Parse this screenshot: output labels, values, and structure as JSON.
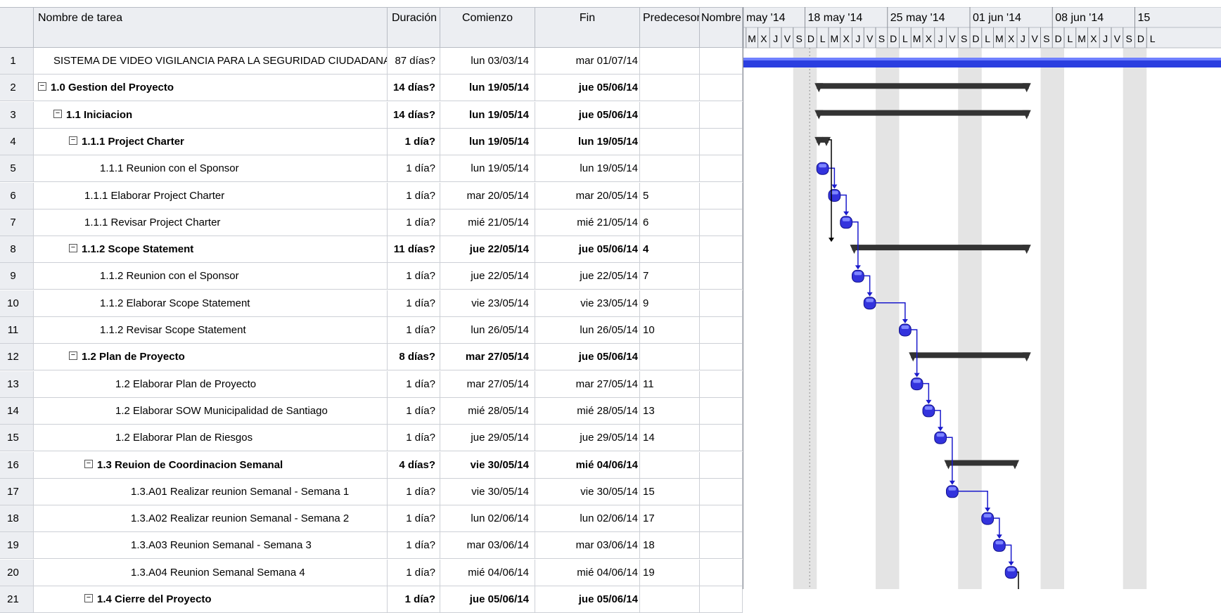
{
  "columns": {
    "name": "Nombre de tarea",
    "duration": "Duración",
    "start": "Comienzo",
    "finish": "Fin",
    "predecessors": "Predecesora",
    "resources": "Nombre"
  },
  "timescale": {
    "weeks": [
      "may '14",
      "18 may '14",
      "25 may '14",
      "01 jun '14",
      "08 jun '14",
      "15"
    ],
    "days": [
      "L",
      "M",
      "X",
      "J",
      "V",
      "S",
      "D",
      "L",
      "M",
      "X",
      "J",
      "V",
      "S",
      "D",
      "L",
      "M",
      "X",
      "J",
      "V",
      "S",
      "D",
      "L",
      "M",
      "X",
      "J",
      "V",
      "S",
      "D",
      "L",
      "M",
      "X",
      "J",
      "V",
      "S",
      "D",
      "L"
    ]
  },
  "tasks": [
    {
      "id": "1",
      "name": "SISTEMA DE VIDEO VIGILANCIA PARA LA SEGURIDAD CIUDADANA",
      "duration": "87 días?",
      "start": "lun 03/03/14",
      "finish": "mar 01/07/14",
      "pred": "",
      "indent": 1,
      "summary": false,
      "bold": false,
      "bar": {
        "type": "project",
        "from": 0,
        "to": 36
      }
    },
    {
      "id": "2",
      "name": "1.0 Gestion del Proyecto",
      "duration": "14 días?",
      "start": "lun 19/05/14",
      "finish": "jue 05/06/14",
      "pred": "",
      "indent": 0,
      "summary": true,
      "bold": true,
      "bar": {
        "type": "summary",
        "from": 7,
        "to": 25
      }
    },
    {
      "id": "3",
      "name": "1.1 Iniciacion",
      "duration": "14 días?",
      "start": "lun 19/05/14",
      "finish": "jue 05/06/14",
      "pred": "",
      "indent": 1,
      "summary": true,
      "bold": true,
      "bar": {
        "type": "summary",
        "from": 7,
        "to": 25
      }
    },
    {
      "id": "4",
      "name": "1.1.1 Project Charter",
      "duration": "1 día?",
      "start": "lun 19/05/14",
      "finish": "lun 19/05/14",
      "pred": "",
      "indent": 2,
      "summary": true,
      "bold": true,
      "bar": {
        "type": "summary",
        "from": 7,
        "to": 8
      }
    },
    {
      "id": "5",
      "name": "1.1.1 Reunion con el Sponsor",
      "duration": "1 día?",
      "start": "lun 19/05/14",
      "finish": "lun 19/05/14",
      "pred": "",
      "indent": 4,
      "summary": false,
      "bold": false,
      "bar": {
        "type": "task",
        "from": 7,
        "to": 8
      }
    },
    {
      "id": "6",
      "name": "1.1.1 Elaborar Project Charter",
      "duration": "1 día?",
      "start": "mar 20/05/14",
      "finish": "mar 20/05/14",
      "pred": "5",
      "indent": 3,
      "summary": false,
      "bold": false,
      "bar": {
        "type": "task",
        "from": 8,
        "to": 9
      }
    },
    {
      "id": "7",
      "name": "1.1.1 Revisar Project Charter",
      "duration": "1 día?",
      "start": "mié 21/05/14",
      "finish": "mié 21/05/14",
      "pred": "6",
      "indent": 3,
      "summary": false,
      "bold": false,
      "bar": {
        "type": "task",
        "from": 9,
        "to": 10
      }
    },
    {
      "id": "8",
      "name": "1.1.2 Scope Statement",
      "duration": "11 días?",
      "start": "jue 22/05/14",
      "finish": "jue 05/06/14",
      "pred": "4",
      "indent": 2,
      "summary": true,
      "bold": true,
      "bar": {
        "type": "summary",
        "from": 10,
        "to": 25
      }
    },
    {
      "id": "9",
      "name": "1.1.2 Reunion con el Sponsor",
      "duration": "1 día?",
      "start": "jue 22/05/14",
      "finish": "jue 22/05/14",
      "pred": "7",
      "indent": 4,
      "summary": false,
      "bold": false,
      "bar": {
        "type": "task",
        "from": 10,
        "to": 11
      }
    },
    {
      "id": "10",
      "name": "1.1.2 Elaborar Scope Statement",
      "duration": "1 día?",
      "start": "vie 23/05/14",
      "finish": "vie 23/05/14",
      "pred": "9",
      "indent": 4,
      "summary": false,
      "bold": false,
      "bar": {
        "type": "task",
        "from": 11,
        "to": 12
      }
    },
    {
      "id": "11",
      "name": "1.1.2 Revisar Scope Statement",
      "duration": "1 día?",
      "start": "lun 26/05/14",
      "finish": "lun 26/05/14",
      "pred": "10",
      "indent": 4,
      "summary": false,
      "bold": false,
      "bar": {
        "type": "task",
        "from": 14,
        "to": 15
      }
    },
    {
      "id": "12",
      "name": "1.2 Plan de Proyecto",
      "duration": "8 días?",
      "start": "mar 27/05/14",
      "finish": "jue 05/06/14",
      "pred": "",
      "indent": 2,
      "summary": true,
      "bold": true,
      "bar": {
        "type": "summary",
        "from": 15,
        "to": 25
      }
    },
    {
      "id": "13",
      "name": "1.2 Elaborar Plan de Proyecto",
      "duration": "1 día?",
      "start": "mar 27/05/14",
      "finish": "mar 27/05/14",
      "pred": "11",
      "indent": 5,
      "summary": false,
      "bold": false,
      "bar": {
        "type": "task",
        "from": 15,
        "to": 16
      }
    },
    {
      "id": "14",
      "name": "1.2 Elaborar SOW Municipalidad de Santiago",
      "duration": "1 día?",
      "start": "mié 28/05/14",
      "finish": "mié 28/05/14",
      "pred": "13",
      "indent": 5,
      "summary": false,
      "bold": false,
      "bar": {
        "type": "task",
        "from": 16,
        "to": 17
      }
    },
    {
      "id": "15",
      "name": "1.2 Elaborar Plan de Riesgos",
      "duration": "1 día?",
      "start": "jue 29/05/14",
      "finish": "jue 29/05/14",
      "pred": "14",
      "indent": 5,
      "summary": false,
      "bold": false,
      "bar": {
        "type": "task",
        "from": 17,
        "to": 18
      }
    },
    {
      "id": "16",
      "name": "1.3 Reuion de Coordinacion Semanal",
      "duration": "4 días?",
      "start": "vie 30/05/14",
      "finish": "mié 04/06/14",
      "pred": "",
      "indent": 3,
      "summary": true,
      "bold": true,
      "bar": {
        "type": "summary",
        "from": 18,
        "to": 24
      }
    },
    {
      "id": "17",
      "name": "1.3.A01 Realizar reunion Semanal - Semana 1",
      "duration": "1 día?",
      "start": "vie 30/05/14",
      "finish": "vie 30/05/14",
      "pred": "15",
      "indent": 6,
      "summary": false,
      "bold": false,
      "bar": {
        "type": "task",
        "from": 18,
        "to": 19
      }
    },
    {
      "id": "18",
      "name": "1.3.A02 Realizar reunion Semanal - Semana 2",
      "duration": "1 día?",
      "start": "lun 02/06/14",
      "finish": "lun 02/06/14",
      "pred": "17",
      "indent": 6,
      "summary": false,
      "bold": false,
      "bar": {
        "type": "task",
        "from": 21,
        "to": 22
      }
    },
    {
      "id": "19",
      "name": "1.3.A03 Reunion Semanal - Semana 3",
      "duration": "1 día?",
      "start": "mar 03/06/14",
      "finish": "mar 03/06/14",
      "pred": "18",
      "indent": 6,
      "summary": false,
      "bold": false,
      "bar": {
        "type": "task",
        "from": 22,
        "to": 23
      }
    },
    {
      "id": "20",
      "name": "1.3.A04 Reunion Semanal  Semana 4",
      "duration": "1 día?",
      "start": "mié 04/06/14",
      "finish": "mié 04/06/14",
      "pred": "19",
      "indent": 6,
      "summary": false,
      "bold": false,
      "bar": {
        "type": "task",
        "from": 23,
        "to": 24
      }
    },
    {
      "id": "21",
      "name": "1.4 Cierre del Proyecto",
      "duration": "1 día?",
      "start": "jue 05/06/14",
      "finish": "jue 05/06/14",
      "pred": "",
      "indent": 3,
      "summary": true,
      "bold": true,
      "bar": {
        "type": "summary",
        "from": 24,
        "to": 25
      }
    }
  ],
  "colors": {
    "task": "#3333dd",
    "summary": "#333333",
    "project": "#2a3ee0",
    "link_blue": "#1a1acc",
    "link_black": "#000000",
    "weekend_shade": "#e4e4e4"
  }
}
